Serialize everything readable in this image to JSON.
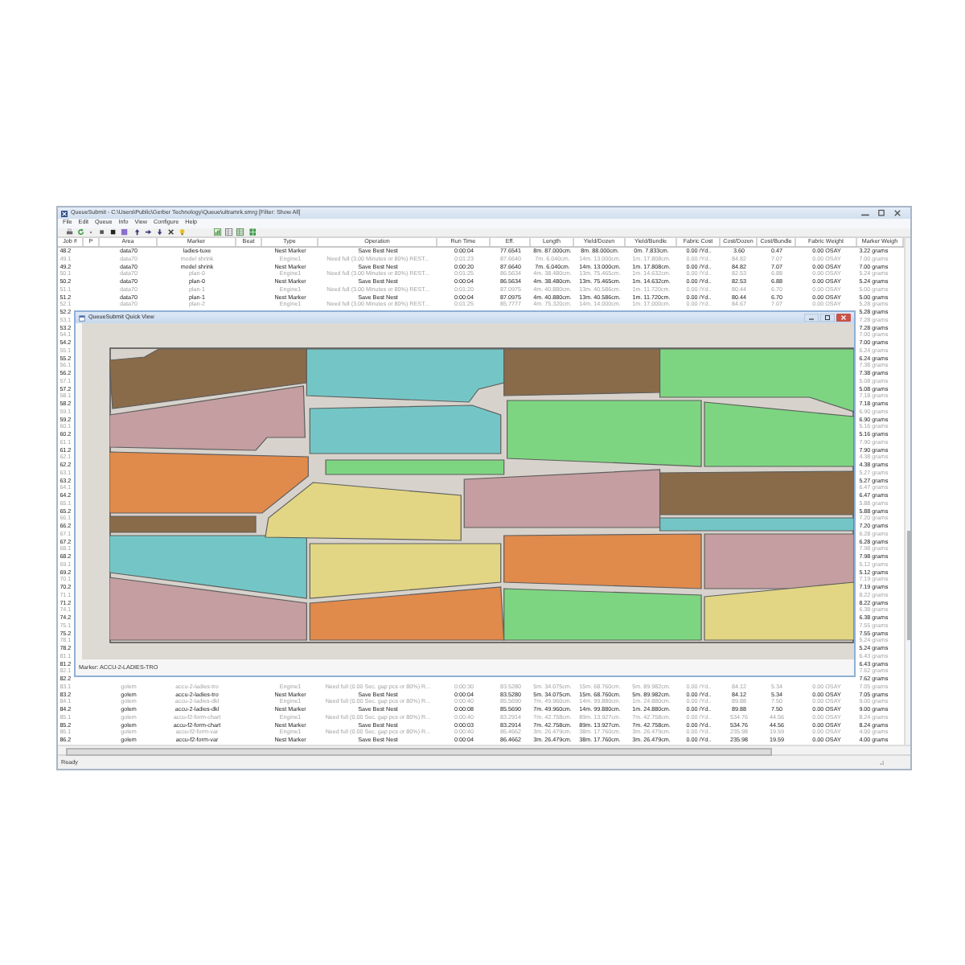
{
  "window": {
    "title": "QueueSubmit - C:\\Users\\Public\\Gerber Technology\\Queue\\ultramrk.smrg [Filter: Show All]"
  },
  "menu": [
    "File",
    "Edit",
    "Queue",
    "Info",
    "View",
    "Configure",
    "Help"
  ],
  "table": {
    "columns": [
      "Job #",
      "P",
      "Area",
      "Marker",
      "Beat",
      "Type",
      "Operation",
      "Run Time",
      "Eff.",
      "Length",
      "Yield/Dozen",
      "Yield/Bundle",
      "Fabric Cost",
      "Cost/Dozen",
      "Cost/Bundle",
      "Fabric Weight",
      "Marker Weigh"
    ],
    "rows": [
      {
        "job": "48.2",
        "greyed": false,
        "area": "data70",
        "marker": "ladies-tuxe",
        "type": "Nest Marker",
        "operation": "Save Best Nest",
        "run_time": "0:00:04",
        "eff": "77.6541",
        "length": "8m. 87.000cm.",
        "yield_dozen": "8m. 88.000cm.",
        "yield_bundle": "0m. 7.833cm.",
        "fabric_cost": "0.00 /Yd..",
        "cost_dozen": "3.60",
        "cost_bundle": "0.47",
        "fabric_weight": "0.00 OSAY",
        "marker_weight": "3.22 grams"
      },
      {
        "job": "49.1",
        "greyed": true,
        "area": "data70",
        "marker": "model shrink",
        "type": "Engine1",
        "operation": "Need full (3.00 Minutes or 80%) REST...",
        "run_time": "0:01:23",
        "eff": "87.6640",
        "length": "7m. 6.040cm.",
        "yield_dozen": "14m. 13.000cm.",
        "yield_bundle": "1m. 17.808cm.",
        "fabric_cost": "0.00 /Yd..",
        "cost_dozen": "84.82",
        "cost_bundle": "7.07",
        "fabric_weight": "0.00 OSAY",
        "marker_weight": "7.00 grams"
      },
      {
        "job": "49.2",
        "greyed": false,
        "area": "data70",
        "marker": "model shrink",
        "type": "Nest Marker",
        "operation": "Save Best Nest",
        "run_time": "0:00:20",
        "eff": "87.6640",
        "length": "7m. 6.040cm.",
        "yield_dozen": "14m. 13.000cm.",
        "yield_bundle": "1m. 17.808cm.",
        "fabric_cost": "0.00 /Yd..",
        "cost_dozen": "84.82",
        "cost_bundle": "7.07",
        "fabric_weight": "0.00 OSAY",
        "marker_weight": "7.00 grams"
      },
      {
        "job": "50.1",
        "greyed": true,
        "area": "data70",
        "marker": "plan-0",
        "type": "Engine1",
        "operation": "Need full (3.00 Minutes or 80%) REST...",
        "run_time": "0:01:25",
        "eff": "86.5634",
        "length": "4m. 38.480cm.",
        "yield_dozen": "13m. 75.465cm.",
        "yield_bundle": "1m. 14.632cm.",
        "fabric_cost": "0.00 /Yd..",
        "cost_dozen": "82.53",
        "cost_bundle": "6.88",
        "fabric_weight": "0.00 OSAY",
        "marker_weight": "5.24 grams"
      },
      {
        "job": "50.2",
        "greyed": false,
        "area": "data70",
        "marker": "plan-0",
        "type": "Nest Marker",
        "operation": "Save Best Nest",
        "run_time": "0:00:04",
        "eff": "86.5634",
        "length": "4m. 38.480cm.",
        "yield_dozen": "13m. 75.465cm.",
        "yield_bundle": "1m. 14.632cm.",
        "fabric_cost": "0.00 /Yd..",
        "cost_dozen": "82.53",
        "cost_bundle": "6.88",
        "fabric_weight": "0.00 OSAY",
        "marker_weight": "5.24 grams"
      },
      {
        "job": "51.1",
        "greyed": true,
        "area": "data70",
        "marker": "plan-1",
        "type": "Engine1",
        "operation": "Need full (3.00 Minutes or 80%) REST...",
        "run_time": "0:01:20",
        "eff": "87.0975",
        "length": "4m. 40.880cm.",
        "yield_dozen": "13m. 40.586cm.",
        "yield_bundle": "1m. 11.720cm.",
        "fabric_cost": "0.00 /Yd..",
        "cost_dozen": "80.44",
        "cost_bundle": "6.70",
        "fabric_weight": "0.00 OSAY",
        "marker_weight": "5.00 grams"
      },
      {
        "job": "51.2",
        "greyed": false,
        "area": "data70",
        "marker": "plan-1",
        "type": "Nest Marker",
        "operation": "Save Best Nest",
        "run_time": "0:00:04",
        "eff": "87.0975",
        "length": "4m. 40.880cm.",
        "yield_dozen": "13m. 40.586cm.",
        "yield_bundle": "1m. 11.720cm.",
        "fabric_cost": "0.00 /Yd..",
        "cost_dozen": "80.44",
        "cost_bundle": "6.70",
        "fabric_weight": "0.00 OSAY",
        "marker_weight": "5.00 grams"
      },
      {
        "job": "52.1",
        "greyed": true,
        "area": "data70",
        "marker": "plan-2",
        "type": "Engine1",
        "operation": "Need full (3.00 Minutes or 80%) REST...",
        "run_time": "0:01:25",
        "eff": "85.7777",
        "length": "4m. 75.320cm.",
        "yield_dozen": "14m. 14.000cm.",
        "yield_bundle": "1m. 17.000cm.",
        "fabric_cost": "0.00 /Yd..",
        "cost_dozen": "84.67",
        "cost_bundle": "7.07",
        "fabric_weight": "0.00 OSAY",
        "marker_weight": "5.28 grams"
      },
      {
        "job": "52.2",
        "greyed": false,
        "marker_weight": "5.28 grams"
      },
      {
        "job": "53.1",
        "greyed": true,
        "marker_weight": "7.28 grams"
      },
      {
        "job": "53.2",
        "greyed": false,
        "marker_weight": "7.28 grams"
      },
      {
        "job": "54.1",
        "greyed": true,
        "marker_weight": "7.00 grams"
      },
      {
        "job": "54.2",
        "greyed": false,
        "marker_weight": "7.00 grams"
      },
      {
        "job": "55.1",
        "greyed": true,
        "marker_weight": "6.24 grams"
      },
      {
        "job": "55.2",
        "greyed": false,
        "marker_weight": "6.24 grams"
      },
      {
        "job": "56.1",
        "greyed": true,
        "marker_weight": "7.38 grams"
      },
      {
        "job": "56.2",
        "greyed": false,
        "marker_weight": "7.38 grams"
      },
      {
        "job": "57.1",
        "greyed": true,
        "marker_weight": "5.08 grams"
      },
      {
        "job": "57.2",
        "greyed": false,
        "marker_weight": "5.08 grams"
      },
      {
        "job": "58.1",
        "greyed": true,
        "marker_weight": "7.18 grams"
      },
      {
        "job": "58.2",
        "greyed": false,
        "marker_weight": "7.18 grams"
      },
      {
        "job": "59.1",
        "greyed": true,
        "marker_weight": "6.90 grams"
      },
      {
        "job": "59.2",
        "greyed": false,
        "marker_weight": "6.90 grams"
      },
      {
        "job": "60.1",
        "greyed": true,
        "marker_weight": "5.16 grams"
      },
      {
        "job": "60.2",
        "greyed": false,
        "marker_weight": "5.16 grams"
      },
      {
        "job": "61.1",
        "greyed": true,
        "marker_weight": "7.90 grams"
      },
      {
        "job": "61.2",
        "greyed": false,
        "marker_weight": "7.90 grams"
      },
      {
        "job": "62.1",
        "greyed": true,
        "marker_weight": "4.38 grams"
      },
      {
        "job": "62.2",
        "greyed": false,
        "marker_weight": "4.38 grams"
      },
      {
        "job": "63.1",
        "greyed": true,
        "marker_weight": "5.27 grams"
      },
      {
        "job": "63.2",
        "greyed": false,
        "marker_weight": "5.27 grams"
      },
      {
        "job": "64.1",
        "greyed": true,
        "marker_weight": "6.47 grams"
      },
      {
        "job": "64.2",
        "greyed": false,
        "marker_weight": "6.47 grams"
      },
      {
        "job": "65.1",
        "greyed": true,
        "marker_weight": "5.88 grams"
      },
      {
        "job": "65.2",
        "greyed": false,
        "marker_weight": "5.88 grams"
      },
      {
        "job": "66.1",
        "greyed": true,
        "marker_weight": "7.20 grams"
      },
      {
        "job": "66.2",
        "greyed": false,
        "marker_weight": "7.20 grams"
      },
      {
        "job": "67.1",
        "greyed": true,
        "marker_weight": "6.28 grams"
      },
      {
        "job": "67.2",
        "greyed": false,
        "marker_weight": "6.28 grams"
      },
      {
        "job": "68.1",
        "greyed": true,
        "marker_weight": "7.98 grams"
      },
      {
        "job": "68.2",
        "greyed": false,
        "marker_weight": "7.98 grams"
      },
      {
        "job": "69.1",
        "greyed": true,
        "marker_weight": "5.12 grams"
      },
      {
        "job": "69.2",
        "greyed": false,
        "marker_weight": "5.12 grams"
      },
      {
        "job": "70.1",
        "greyed": true,
        "marker_weight": "7.19 grams"
      },
      {
        "job": "70.2",
        "greyed": false,
        "marker_weight": "7.19 grams"
      },
      {
        "job": "71.1",
        "greyed": true,
        "marker_weight": "8.22 grams"
      },
      {
        "job": "71.2",
        "greyed": false,
        "marker_weight": "8.22 grams"
      },
      {
        "job": "74.1",
        "greyed": true,
        "marker_weight": "6.38 grams"
      },
      {
        "job": "74.2",
        "greyed": false,
        "marker_weight": "6.38 grams"
      },
      {
        "job": "75.1",
        "greyed": true,
        "marker_weight": "7.55 grams"
      },
      {
        "job": "75.2",
        "greyed": false,
        "marker_weight": "7.55 grams"
      },
      {
        "job": "78.1",
        "greyed": true,
        "marker_weight": "5.24 grams"
      },
      {
        "job": "78.2",
        "greyed": false,
        "marker_weight": "5.24 grams"
      },
      {
        "job": "81.1",
        "greyed": true,
        "marker_weight": "6.43 grams"
      },
      {
        "job": "81.2",
        "greyed": false,
        "marker_weight": "6.43 grams"
      },
      {
        "job": "82.1",
        "greyed": true,
        "marker_weight": "7.62 grams"
      },
      {
        "job": "82.2",
        "greyed": false,
        "marker_weight": "7.62 grams"
      },
      {
        "job": "83.1",
        "greyed": true,
        "area": "golem",
        "marker": "accu-2-ladies-tro",
        "type": "Engine1",
        "operation": "Need full (0.00 Sec. gap pcs or 80%) R...",
        "run_time": "0:00:30",
        "eff": "83.5280",
        "length": "5m. 34.075cm.",
        "yield_dozen": "15m. 68.760cm.",
        "yield_bundle": "5m. 89.982cm.",
        "fabric_cost": "0.00 /Yd..",
        "cost_dozen": "84.12",
        "cost_bundle": "5.34",
        "fabric_weight": "0.00 OSAY",
        "marker_weight": "7.05 grams"
      },
      {
        "job": "83.2",
        "greyed": false,
        "area": "golem",
        "marker": "accu-2-ladies-tro",
        "type": "Nest Marker",
        "operation": "Save Best Nest",
        "run_time": "0:00:04",
        "eff": "83.5280",
        "length": "5m. 34.075cm.",
        "yield_dozen": "15m. 68.760cm.",
        "yield_bundle": "5m. 89.982cm.",
        "fabric_cost": "0.00 /Yd..",
        "cost_dozen": "84.12",
        "cost_bundle": "5.34",
        "fabric_weight": "0.00 OSAY",
        "marker_weight": "7.05 grams"
      },
      {
        "job": "84.1",
        "greyed": true,
        "area": "golem",
        "marker": "accu-2-ladies-dkl",
        "type": "Engine1",
        "operation": "Need full (0.00 Sec. gap pcs or 80%) R...",
        "run_time": "0:00:40",
        "eff": "85.5690",
        "length": "7m. 49.960cm.",
        "yield_dozen": "14m. 99.880cm.",
        "yield_bundle": "1m. 24.880cm.",
        "fabric_cost": "0.00 /Yd..",
        "cost_dozen": "89.88",
        "cost_bundle": "7.50",
        "fabric_weight": "0.00 OSAY",
        "marker_weight": "9.00 grams"
      },
      {
        "job": "84.2",
        "greyed": false,
        "area": "golem",
        "marker": "accu-2-ladies-dkl",
        "type": "Nest Marker",
        "operation": "Save Best Nest",
        "run_time": "0:00:08",
        "eff": "85.5690",
        "length": "7m. 49.960cm.",
        "yield_dozen": "14m. 99.880cm.",
        "yield_bundle": "1m. 24.880cm.",
        "fabric_cost": "0.00 /Yd..",
        "cost_dozen": "89.88",
        "cost_bundle": "7.50",
        "fabric_weight": "0.00 OSAY",
        "marker_weight": "9.00 grams"
      },
      {
        "job": "85.1",
        "greyed": true,
        "area": "golem",
        "marker": "accu-f2-form-chart",
        "type": "Engine1",
        "operation": "Need full (0.00 Sec. gap pcs or 80%) R...",
        "run_time": "0:00:40",
        "eff": "83.2914",
        "length": "7m. 42.758cm.",
        "yield_dozen": "89m. 13.927cm.",
        "yield_bundle": "7m. 42.758cm.",
        "fabric_cost": "0.00 /Yd..",
        "cost_dozen": "534.76",
        "cost_bundle": "44.56",
        "fabric_weight": "0.00 OSAY",
        "marker_weight": "8.24 grams"
      },
      {
        "job": "85.2",
        "greyed": false,
        "area": "golem",
        "marker": "accu-f2-form-chart",
        "type": "Nest Marker",
        "operation": "Save Best Nest",
        "run_time": "0:00:03",
        "eff": "83.2914",
        "length": "7m. 42.758cm.",
        "yield_dozen": "89m. 13.927cm.",
        "yield_bundle": "7m. 42.758cm.",
        "fabric_cost": "0.00 /Yd..",
        "cost_dozen": "534.76",
        "cost_bundle": "44.56",
        "fabric_weight": "0.00 OSAY",
        "marker_weight": "8.24 grams"
      },
      {
        "job": "86.1",
        "greyed": true,
        "area": "golem",
        "marker": "accu-f2-form-var",
        "type": "Engine1",
        "operation": "Need full (0.00 Sec. gap pcs or 80%) R...",
        "run_time": "0:00:40",
        "eff": "86.4662",
        "length": "3m. 26.479cm.",
        "yield_dozen": "38m. 17.760cm.",
        "yield_bundle": "3m. 26.479cm.",
        "fabric_cost": "0.00 /Yd..",
        "cost_dozen": "235.98",
        "cost_bundle": "19.59",
        "fabric_weight": "0.00 OSAY",
        "marker_weight": "4.00 grams"
      },
      {
        "job": "86.2",
        "greyed": false,
        "area": "golem",
        "marker": "accu-f2-form-var",
        "type": "Nest Marker",
        "operation": "Save Best Nest",
        "run_time": "0:00:04",
        "eff": "86.4662",
        "length": "3m. 26.479cm.",
        "yield_dozen": "38m. 17.760cm.",
        "yield_bundle": "3m. 26.479cm.",
        "fabric_cost": "0.00 /Yd..",
        "cost_dozen": "235.98",
        "cost_bundle": "19.59",
        "fabric_weight": "0.00 OSAY",
        "marker_weight": "4.00 grams"
      }
    ]
  },
  "quick_view": {
    "title": "QueueSubmit Quick View",
    "status": "Marker: ACCU-2-LADIES-TRO"
  },
  "status_bar": {
    "text": "Ready"
  }
}
